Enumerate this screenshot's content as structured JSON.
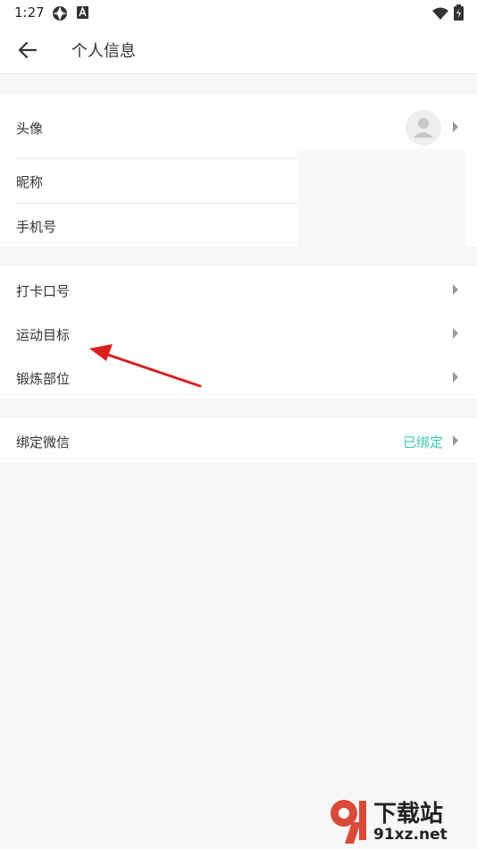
{
  "status_bar": {
    "time": "1:27"
  },
  "header": {
    "title": "个人信息"
  },
  "profile": {
    "avatar_label": "头像",
    "nickname_label": "昵称",
    "phone_label": "手机号"
  },
  "fitness": {
    "slogan_label": "打卡口号",
    "goal_label": "运动目标",
    "body_part_label": "锻炼部位"
  },
  "wechat": {
    "label": "绑定微信",
    "status": "已绑定",
    "status_color": "#3ec9b0"
  },
  "watermark": {
    "title": "下载站",
    "domain": "91xz.net"
  }
}
